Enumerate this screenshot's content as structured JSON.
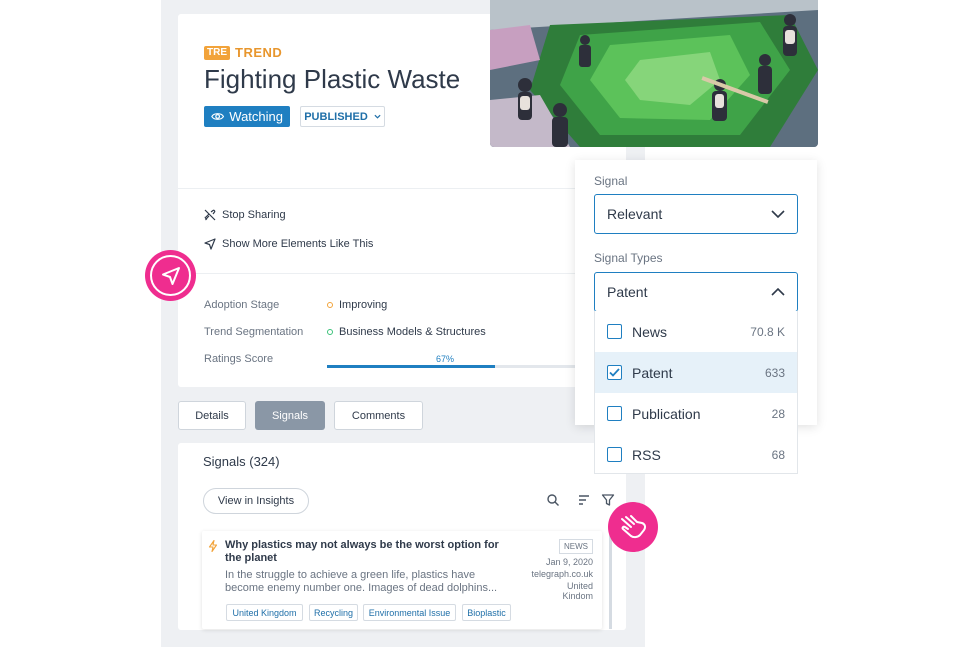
{
  "trend": {
    "badge_chip": "TRE",
    "badge_word": "TREND",
    "title": "Fighting Plastic Waste",
    "watching_label": "Watching",
    "status_label": "PUBLISHED"
  },
  "actions": {
    "stop_sharing": "Stop Sharing",
    "show_more": "Show More Elements Like This"
  },
  "meta": {
    "adoption_label": "Adoption Stage",
    "adoption_value": "Improving",
    "segmentation_label": "Trend Segmentation",
    "segmentation_value": "Business Models & Structures",
    "ratings_label": "Ratings Score",
    "ratings_value": "67%",
    "ratings_fraction": 0.67
  },
  "tabs": {
    "details": "Details",
    "signals": "Signals",
    "comments": "Comments"
  },
  "signals": {
    "heading": "Signals (324)",
    "insights_button": "View in Insights",
    "item": {
      "title": "Why plastics may not always be the worst option for the planet",
      "body": "In the struggle to achieve a green life, plastics have become enemy number one. Images of dead dolphins...",
      "type": "NEWS",
      "date": "Jan 9, 2020",
      "source": "telegraph.co.uk",
      "country_line1": "United",
      "country_line2": "Kindom",
      "tags": [
        "United Kingdom",
        "Recycling",
        "Environmental Issue",
        "Bioplastic"
      ]
    }
  },
  "filter": {
    "signal_label": "Signal",
    "signal_value": "Relevant",
    "types_label": "Signal Types",
    "types_value": "Patent",
    "options": [
      {
        "label": "News",
        "count": "70.8 K",
        "checked": false
      },
      {
        "label": "Patent",
        "count": "633",
        "checked": true
      },
      {
        "label": "Publication",
        "count": "28",
        "checked": false
      },
      {
        "label": "RSS",
        "count": "68",
        "checked": false
      }
    ]
  },
  "colors": {
    "accent": "#1f7fc1",
    "trend_orange": "#e8962d",
    "pink": "#ef2d8f",
    "adoption_dot": "#f2a33a",
    "segmentation_dot": "#3cc27a"
  },
  "icons": {
    "watch": "eye-icon",
    "stop_sharing": "link-off-icon",
    "show_more": "send-icon",
    "search": "search-icon",
    "sort": "sort-icon",
    "filter": "filter-icon",
    "signal_type": "lightning-icon",
    "pink_top": "send-icon",
    "pink_bottom": "hand-pointer-icon"
  }
}
